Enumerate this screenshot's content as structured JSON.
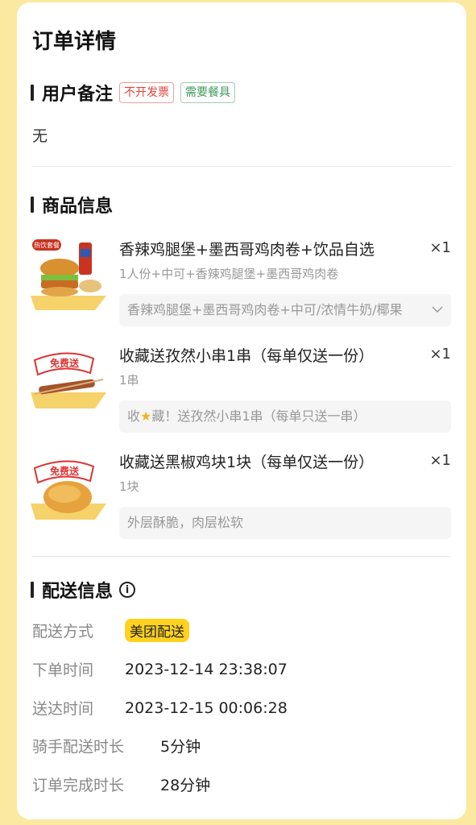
{
  "page": {
    "title": "订单详情"
  },
  "user_note": {
    "heading": "用户备注",
    "tags": [
      "不开发票",
      "需要餐具"
    ],
    "content": "无"
  },
  "products": {
    "heading": "商品信息",
    "items": [
      {
        "name": "香辣鸡腿堡+墨西哥鸡肉卷+饮品自选",
        "qty": "×1",
        "spec": "1人份+中可+香辣鸡腿堡+墨西哥鸡肉卷",
        "detail": "香辣鸡腿堡+墨西哥鸡肉卷+中可/浓情牛奶/椰果",
        "image_badge": "热饮套餐"
      },
      {
        "name": "收藏送孜然小串1串（每单仅送一份）",
        "qty": "×1",
        "spec": "1串",
        "detail_pre": "收",
        "detail_post": "藏！送孜然小串1串（每单只送一串）",
        "image_badge": "免费送"
      },
      {
        "name": "收藏送黑椒鸡块1块（每单仅送一份）",
        "qty": "×1",
        "spec": "1块",
        "detail": "外层酥脆，肉层松软",
        "image_badge": "免费送"
      }
    ]
  },
  "delivery": {
    "heading": "配送信息",
    "info_icon_glyph": "i",
    "rows": [
      {
        "label": "配送方式",
        "value": "美团配送"
      },
      {
        "label": "下单时间",
        "value": "2023-12-14 23:38:07"
      },
      {
        "label": "送达时间",
        "value": "2023-12-15 00:06:28"
      },
      {
        "label": "骑手配送时长",
        "value": "5分钟"
      },
      {
        "label": "订单完成时长",
        "value": "28分钟"
      }
    ]
  },
  "colors": {
    "background": "#fbe9a2",
    "badge": "#ffd21f",
    "tag_red": "#e5413a",
    "tag_green": "#3d9b5b"
  }
}
